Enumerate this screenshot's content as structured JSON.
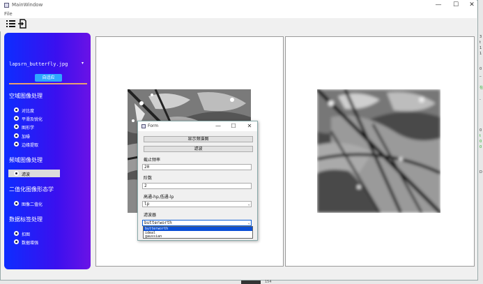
{
  "window": {
    "title": "MainWindow",
    "menu_file": "File",
    "controls": {
      "minimize": "—",
      "maximize": "☐",
      "close": "✕"
    }
  },
  "toolbar": {
    "icons": [
      "list-icon",
      "export-icon"
    ]
  },
  "sidebar": {
    "file_name": "lapsrn_butterfly.jpg",
    "file_arrow": "▾",
    "adapt_button": "自适应",
    "sections": [
      {
        "title": "空域图像处理",
        "items": [
          "对比度",
          "平滑及锐化",
          "图形学",
          "加噪",
          "边缘提取"
        ]
      },
      {
        "title": "频域图像处理",
        "items": [
          "滤波"
        ]
      },
      {
        "title": "二值化图像形态学",
        "items": [
          "图像二值化"
        ]
      },
      {
        "title": "数据标签处理",
        "items": [
          "扣图",
          "数据增强"
        ]
      }
    ]
  },
  "form": {
    "title": "Form",
    "controls": {
      "minimize": "—",
      "maximize": "☐",
      "close": "✕"
    },
    "show_spectrum_button": "显示频谱图",
    "filter_button": "滤波",
    "cutoff_label": "截止频率",
    "cutoff_value": "20",
    "order_label": "阶数",
    "order_value": "2",
    "pass_label": "高通-hp,低通-lp",
    "pass_value": "lp",
    "filter_type_label": "滤波器",
    "filter_type_value": "butterworth",
    "filter_options": [
      "butterworth",
      "ideal",
      "gaussian"
    ],
    "combo_arrow": "⌄"
  },
  "edge": {
    "snippets": [
      "3",
      "t",
      "1",
      "1",
      "0",
      "_",
      "在",
      "-",
      "0",
      "t",
      "0",
      "0",
      "D"
    ]
  },
  "bottom": {
    "number": "154"
  }
}
